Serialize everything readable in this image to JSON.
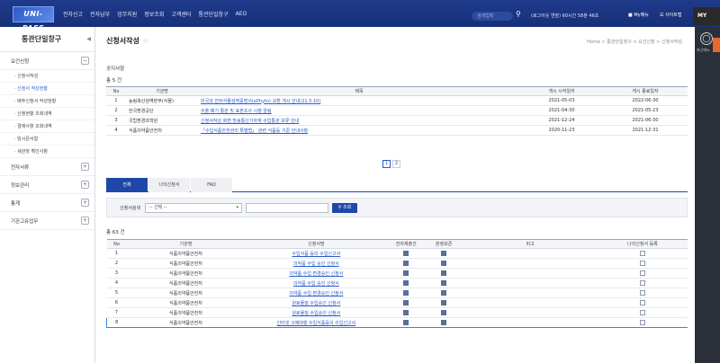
{
  "header": {
    "logo": "UNI-PASS",
    "menu": [
      "전자신고",
      "전자납부",
      "업무지원",
      "정보조회",
      "고객센터",
      "통관단일창구",
      "AEO"
    ],
    "search_placeholder": "검색입력",
    "session": "(로그아웃 연장) 60시간 58분 46초",
    "my_menu": "My메뉴",
    "sitemap": "사이트맵",
    "my": "MY"
  },
  "rail": {
    "label": "최근메뉴"
  },
  "sidebar": {
    "title": "통관단일창구",
    "items": [
      {
        "label": "요건신청",
        "type": "group",
        "toggle": "−"
      },
      {
        "label": "· 신청서작성",
        "type": "sub"
      },
      {
        "label": "· 신청서 작성현황",
        "type": "sub",
        "active": true
      },
      {
        "label": "· 배주신청서 작성현황",
        "type": "sub"
      },
      {
        "label": "· 신청현황 조회내역",
        "type": "sub"
      },
      {
        "label": "· 결재사항 조회내역",
        "type": "sub"
      },
      {
        "label": "· 임시문서함",
        "type": "sub"
      },
      {
        "label": "· 세관장 확인사항",
        "type": "sub"
      },
      {
        "label": "전자서류",
        "type": "group",
        "toggle": "+"
      },
      {
        "label": "정보관리",
        "type": "group",
        "toggle": "+"
      },
      {
        "label": "통계",
        "type": "group",
        "toggle": "+"
      },
      {
        "label": "기관고유업무",
        "type": "group",
        "toggle": "+"
      }
    ]
  },
  "main": {
    "title": "신청서작성",
    "breadcrumb": "Home > 통관단일창구 > 요건신청 > 신청서작성",
    "notice": {
      "label": "공지사항",
      "count": "총 5 건",
      "headers": [
        "No",
        "기관명",
        "제목",
        "게시 시작일자",
        "게시 종료일자"
      ],
      "rows": [
        [
          "1",
          "농림축산검역본부(식물)",
          "미국과 전자식물검역증명서(ePhyto) 교환 개시 안내(21.5.10)",
          "2021-05-03",
          "2022-06-30"
        ],
        [
          "2",
          "한국환경공단",
          "수출 폐기 통관 및 표본조사 시행 알림",
          "2021-04-30",
          "2021-05-23"
        ],
        [
          "3",
          "국립환경과학원",
          "신청서작성 화면 방송통신기자재 수입통관 보류 안내",
          "2021-12-24",
          "2021-06-30"
        ],
        [
          "4",
          "식품의약품안전처",
          "「수입식품안전관리 특별법」 관련 식품등 기준 안내사항",
          "2020-11-23",
          "2021-12-31"
        ]
      ],
      "pages": [
        "1",
        "2"
      ]
    },
    "tabs": [
      "전체",
      "나의신청서",
      "FAQ"
    ],
    "filter": {
      "label": "신청서검색",
      "select": "-- 선택 --",
      "button": "조회"
    },
    "list": {
      "count": "총 63 건",
      "headers": [
        "No",
        "기관명",
        "신청서명",
        "전자제출건",
        "본청보존",
        "비고",
        "나의신청서 등록"
      ],
      "rows": [
        [
          "1",
          "식품의약품안전처",
          "수입식품 등의 수입신고서"
        ],
        [
          "2",
          "식품의약품안전처",
          "의약품 수입 승인 신청서"
        ],
        [
          "3",
          "식품의약품안전처",
          "의약품 수입 변경승인 신청서"
        ],
        [
          "4",
          "식품의약품안전처",
          "의약품 수입 승인 신청서"
        ],
        [
          "5",
          "식품의약품안전처",
          "의약품 수입 변경승인 신청서"
        ],
        [
          "6",
          "식품의약품안전처",
          "원료물질 수입승인 신청서"
        ],
        [
          "7",
          "식품의약품안전처",
          "원료물질 수입승인 신청서"
        ],
        [
          "8",
          "식품의약품안전처",
          "인터넷 구매대행 수입식품등의 수입신고서"
        ]
      ]
    }
  }
}
